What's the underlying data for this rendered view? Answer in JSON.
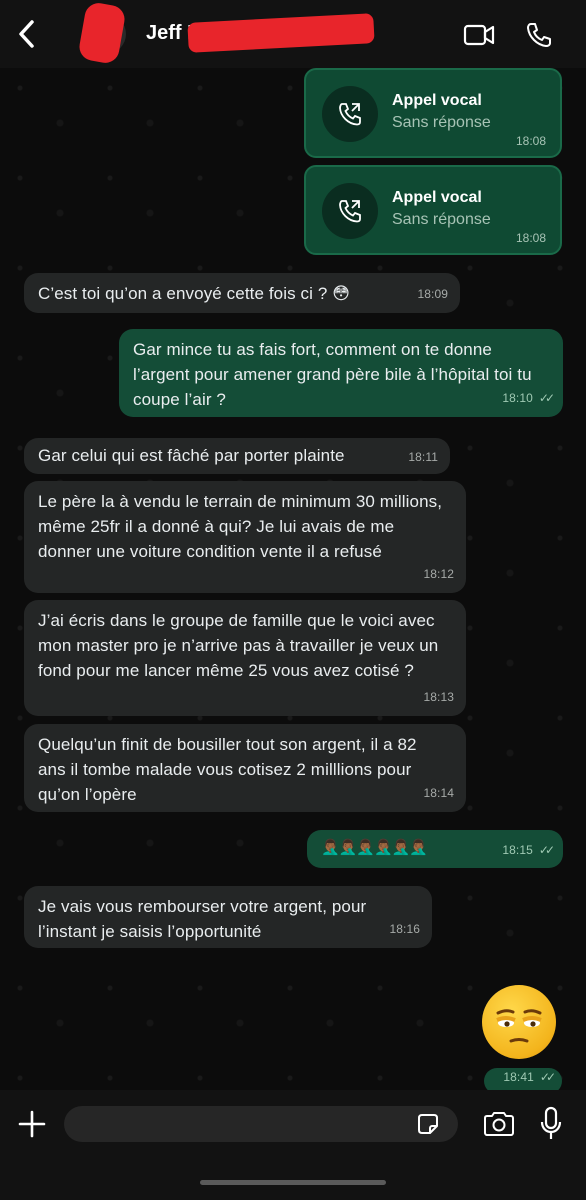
{
  "header": {
    "contact_name": "Jeff Mi",
    "back_icon": "chevron-left-icon",
    "video_icon": "video-camera-icon",
    "call_icon": "phone-icon"
  },
  "calls": [
    {
      "title": "Appel vocal",
      "subtitle": "Sans réponse",
      "time": "18:08"
    },
    {
      "title": "Appel vocal",
      "subtitle": "Sans réponse",
      "time": "18:08"
    }
  ],
  "messages": [
    {
      "dir": "in",
      "text": "C’est toi qu’on a envoyé cette fois ci ? 😳",
      "time": "18:09"
    },
    {
      "dir": "out",
      "text": "Gar mince tu as fais fort, comment on te donne l’argent pour amener grand père bile à l’hôpital toi tu coupe l’air ?",
      "time": "18:10"
    },
    {
      "dir": "in",
      "text": "Gar celui qui est fâché par porter plainte",
      "time": "18:11"
    },
    {
      "dir": "in",
      "text": "Le père la à vendu le terrain de minimum 30 millions, même 25fr il a donné à qui? Je lui avais de me donner une voiture condition vente il a refusé",
      "time": "18:12"
    },
    {
      "dir": "in",
      "text": "J’ai écris dans le groupe de famille que le voici avec mon master pro je n’arrive pas à travailler je veux un fond pour me lancer même 25 vous avez cotisé ?",
      "time": "18:13"
    },
    {
      "dir": "in",
      "text": "Quelqu’un finit de bousiller tout son argent, il a 82 ans il tombe malade vous cotisez 2 milllions pour qu’on l’opère",
      "time": "18:14"
    },
    {
      "dir": "out",
      "text": "🤦🏾‍♂️🤦🏾‍♂️🤦🏾‍♂️🤦🏾‍♂️🤦🏾‍♂️🤦🏾‍♂️",
      "time": "18:15"
    },
    {
      "dir": "in",
      "text": "Je vais vous rembourser votre argent, pour l’instant je saisis l’opportunité",
      "time": "18:16"
    },
    {
      "dir": "out",
      "text": "😔",
      "time": "18:41"
    }
  ],
  "composer": {
    "placeholder": "",
    "plus_icon": "plus-icon",
    "sticker_icon": "sticker-icon",
    "camera_icon": "camera-icon",
    "mic_icon": "microphone-icon"
  },
  "colors": {
    "outgoing_bubble": "#144d37",
    "incoming_bubble": "#242626",
    "background": "#0b0b0b"
  }
}
